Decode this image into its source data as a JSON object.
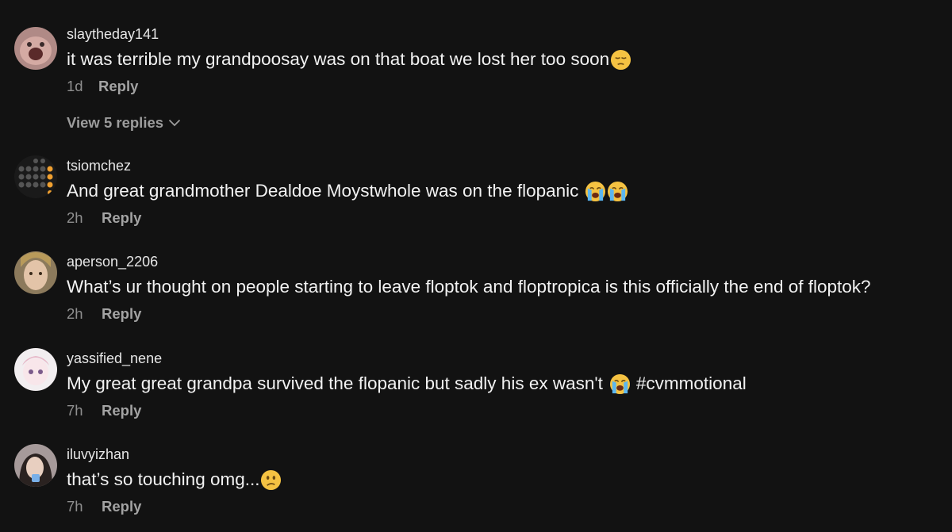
{
  "comments": [
    {
      "username": "slaytheday141",
      "text": "it was terrible my grandpoosay was on that boat we lost her too soon",
      "emojis": [
        "pensive-face"
      ],
      "time": "1d",
      "reply_label": "Reply",
      "view_replies": "View 5 replies"
    },
    {
      "username": "tsiomchez",
      "text": "And great grandmother Dealdoe Moystwhole was on the flopanic",
      "emojis": [
        "loudly-crying-face",
        "loudly-crying-face"
      ],
      "time": "2h",
      "reply_label": "Reply"
    },
    {
      "username": "aperson_2206",
      "text": "What’s ur thought on people starting to leave floptok and floptropica is this officially the end of floptok?",
      "time": "2h",
      "reply_label": "Reply"
    },
    {
      "username": "yassified_nene",
      "text": "My great great grandpa survived the flopanic but sadly his ex wasn't",
      "text_after": "#cvmmotional",
      "emojis": [
        "loudly-crying-face"
      ],
      "time": "7h",
      "reply_label": "Reply"
    },
    {
      "username": "iluvyizhan",
      "text": "that’s so touching omg...",
      "emojis": [
        "confused-face"
      ],
      "time": "7h",
      "reply_label": "Reply"
    }
  ],
  "colors": {
    "background": "#121212",
    "username": "#e6e6e6",
    "text": "#f2f2f2",
    "meta": "#8f8f8f",
    "reply": "#a3a3a3"
  }
}
